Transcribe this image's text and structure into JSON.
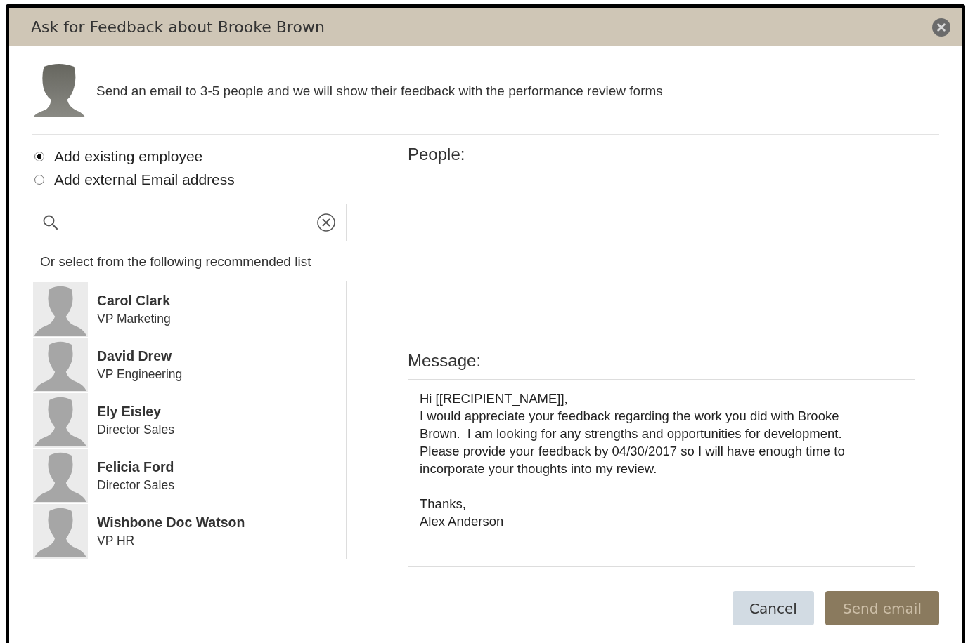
{
  "dialog": {
    "title": "Ask for Feedback about Brooke Brown"
  },
  "intro": {
    "text": "Send an email to 3-5 people and we will show their feedback with the performance review forms"
  },
  "add_options": [
    {
      "label": "Add existing employee",
      "selected": true
    },
    {
      "label": "Add external Email address",
      "selected": false
    }
  ],
  "recommended": {
    "caption": "Or select from the following recommended list",
    "people": [
      {
        "name": "Carol Clark",
        "title": "VP Marketing"
      },
      {
        "name": "David Drew",
        "title": "VP Engineering"
      },
      {
        "name": "Ely Eisley",
        "title": "Director Sales"
      },
      {
        "name": "Felicia Ford",
        "title": "Director Sales"
      },
      {
        "name": "Wishbone Doc Watson",
        "title": "VP HR"
      }
    ]
  },
  "people_label": "People:",
  "message": {
    "label": "Message:",
    "paragraphs": [
      [
        "Hi [[RECIPIENT_NAME]],",
        "I would appreciate your feedback regarding the work you did with Brooke",
        "Brown.  I am looking for any strengths and opportunities for development.",
        "Please provide your feedback by 04/30/2017 so I will have enough time to",
        "incorporate your thoughts into my review."
      ],
      [
        "Thanks,",
        "Alex Anderson"
      ]
    ]
  },
  "buttons": [
    {
      "label": "Cancel",
      "kind": "secondary",
      "disabled": false
    },
    {
      "label": "Send email",
      "kind": "primary",
      "disabled": true
    }
  ]
}
